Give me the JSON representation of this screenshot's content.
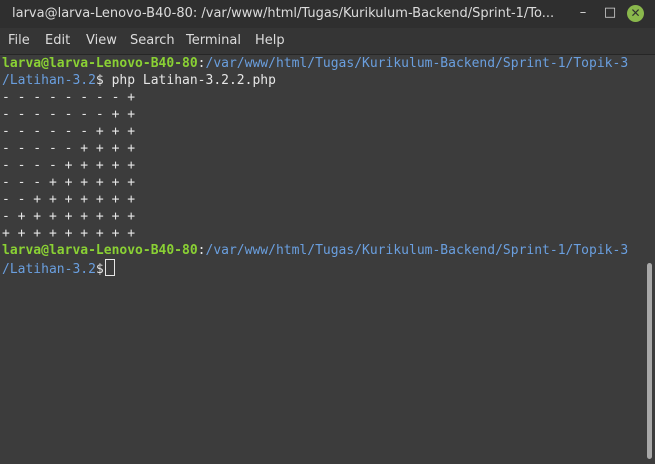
{
  "window": {
    "title": "larva@larva-Lenovo-B40-80: /var/www/html/Tugas/Kurikulum-Backend/Sprint-1/To...",
    "minimize_label": "–",
    "maximize_label": "□",
    "close_label": "✕"
  },
  "menubar": {
    "file": "File",
    "edit": "Edit",
    "view": "View",
    "search": "Search",
    "terminal": "Terminal",
    "help": "Help"
  },
  "terminal": {
    "prompt1": {
      "user": "larva@larva-Lenovo-B40-80",
      "sep": ":",
      "path": "/var/www/html/Tugas/Kurikulum-Backend/Sprint-1/Topik-3",
      "path_cont": "/Latihan-3.2",
      "symbol": "$",
      "command": " php Latihan-3.2.2.php"
    },
    "output": [
      "- - - - - - - - +",
      "- - - - - - - + +",
      "- - - - - - + + +",
      "- - - - - + + + +",
      "- - - - + + + + +",
      "- - - + + + + + +",
      "- - + + + + + + +",
      "- + + + + + + + +",
      "+ + + + + + + + +"
    ],
    "prompt2": {
      "user": "larva@larva-Lenovo-B40-80",
      "sep": ":",
      "path": "/var/www/html/Tugas/Kurikulum-Backend/Sprint-1/Topik-3",
      "path_cont": "/Latihan-3.2",
      "symbol": "$"
    }
  },
  "colors": {
    "user": "#8ad134",
    "path": "#6a9fdf",
    "text": "#e6e6e6",
    "background": "#3c3c3c",
    "close_button": "#8ab84c"
  },
  "icons": {
    "minimize": "minimize-icon",
    "maximize": "maximize-icon",
    "close": "close-icon"
  }
}
